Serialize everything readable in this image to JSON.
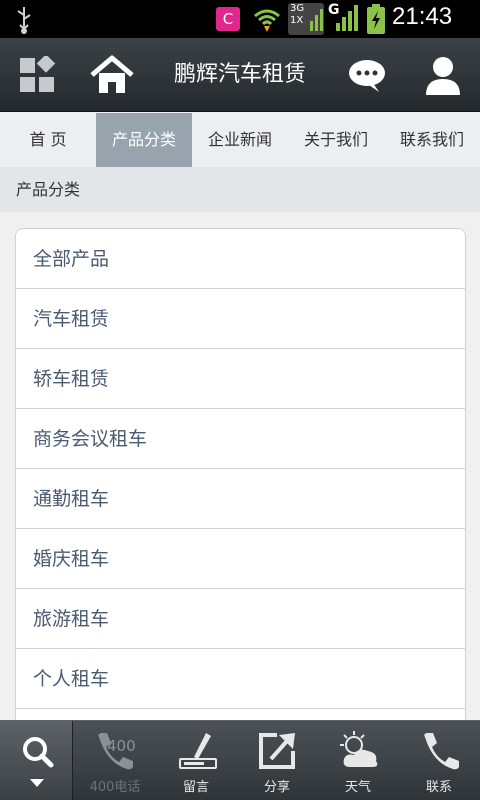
{
  "status_bar": {
    "app_badge": "C",
    "net_type": "3G",
    "net_sub": "1X",
    "signal_letter": "G",
    "time": "21:43"
  },
  "header": {
    "title": "鹏辉汽车租赁",
    "icons": [
      "grid-menu-icon",
      "home-icon",
      "chat-icon",
      "user-icon"
    ]
  },
  "tabs": [
    {
      "label": "首 页",
      "active": false
    },
    {
      "label": "产品分类",
      "active": true
    },
    {
      "label": "企业新闻",
      "active": false
    },
    {
      "label": "关于我们",
      "active": false
    },
    {
      "label": "联系我们",
      "active": false
    }
  ],
  "breadcrumb": "产品分类",
  "categories": [
    "全部产品",
    "汽车租赁",
    "轿车租赁",
    "商务会议租车",
    "通勤租车",
    "婚庆租车",
    "旅游租车",
    "个人租车"
  ],
  "bottom_bar": {
    "phone_badge": "400",
    "items": [
      {
        "label": "400电话",
        "icon": "phone-icon",
        "enabled": false
      },
      {
        "label": "留言",
        "icon": "pen-icon",
        "enabled": true
      },
      {
        "label": "分享",
        "icon": "share-icon",
        "enabled": true
      },
      {
        "label": "天气",
        "icon": "weather-icon",
        "enabled": true
      },
      {
        "label": "联系",
        "icon": "call-icon",
        "enabled": true
      }
    ]
  },
  "colors": {
    "active_tab": "#98a4ad",
    "list_text": "#4a5b72",
    "header_bg": "#2e3438"
  }
}
